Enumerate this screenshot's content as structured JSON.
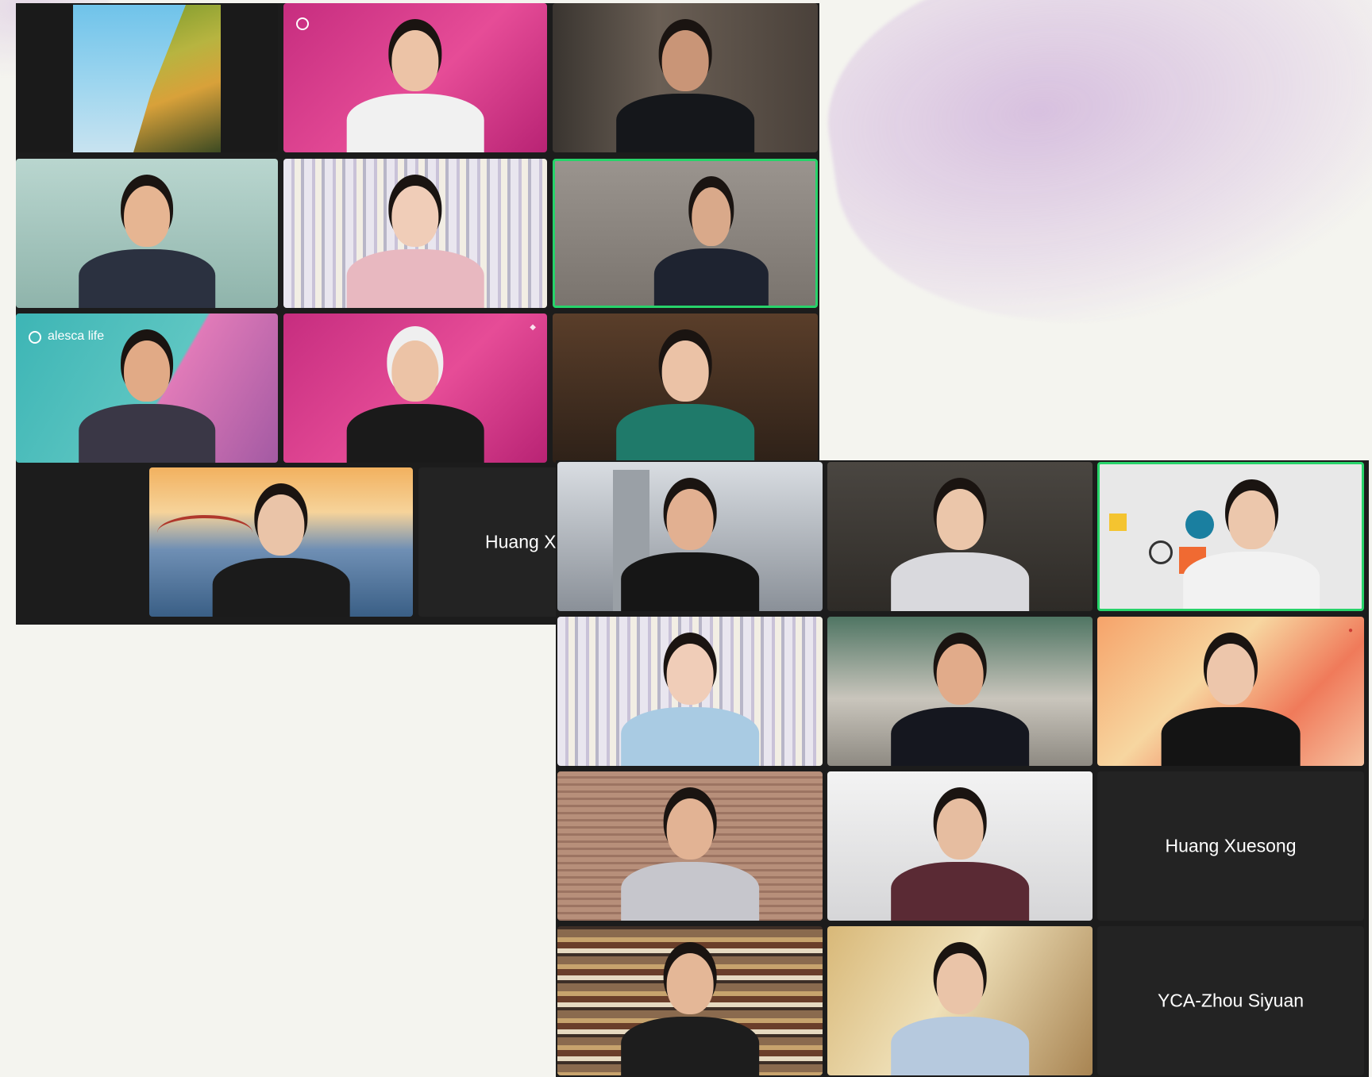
{
  "meeting": {
    "participants_a": [
      {
        "id": "a1",
        "background": "plant-terrace"
      },
      {
        "id": "a2",
        "background": "pink-brand"
      },
      {
        "id": "a3",
        "background": "bookshelf-blur"
      },
      {
        "id": "a4",
        "background": "teal-wall"
      },
      {
        "id": "a5",
        "background": "striped-curtain"
      },
      {
        "id": "a6",
        "background": "grey-wall",
        "active": true
      },
      {
        "id": "a7",
        "background": "alesca-brand",
        "logo": "alesca life"
      },
      {
        "id": "a8",
        "background": "pink-brand"
      },
      {
        "id": "a9",
        "background": "lounge"
      },
      {
        "id": "a10",
        "background": "golden-gate"
      },
      {
        "id": "a11",
        "camera_off": true,
        "name": "Huang X"
      }
    ],
    "participants_b": [
      {
        "id": "b1",
        "background": "city-window"
      },
      {
        "id": "b2",
        "background": "dim-room"
      },
      {
        "id": "b3",
        "background": "b-corp-brand",
        "active": true
      },
      {
        "id": "b4",
        "background": "striped-curtain"
      },
      {
        "id": "b5",
        "background": "kitchen"
      },
      {
        "id": "b6",
        "background": "orange-brand"
      },
      {
        "id": "b7",
        "background": "blinds"
      },
      {
        "id": "b8",
        "background": "office"
      },
      {
        "id": "b9",
        "camera_off": true,
        "name": "Huang Xuesong"
      },
      {
        "id": "b10",
        "background": "library"
      },
      {
        "id": "b11",
        "background": "ornate-room"
      },
      {
        "id": "b12",
        "camera_off": true,
        "name": "YCA-Zhou Siyuan"
      }
    ]
  },
  "colors": {
    "page_background": "#f4f4ef",
    "grid_background": "#1c1c1c",
    "tile_off_background": "#232323",
    "active_speaker_border": "#27d36a",
    "brand_pink": "#c9327e",
    "brand_teal": "#3db5b5"
  }
}
